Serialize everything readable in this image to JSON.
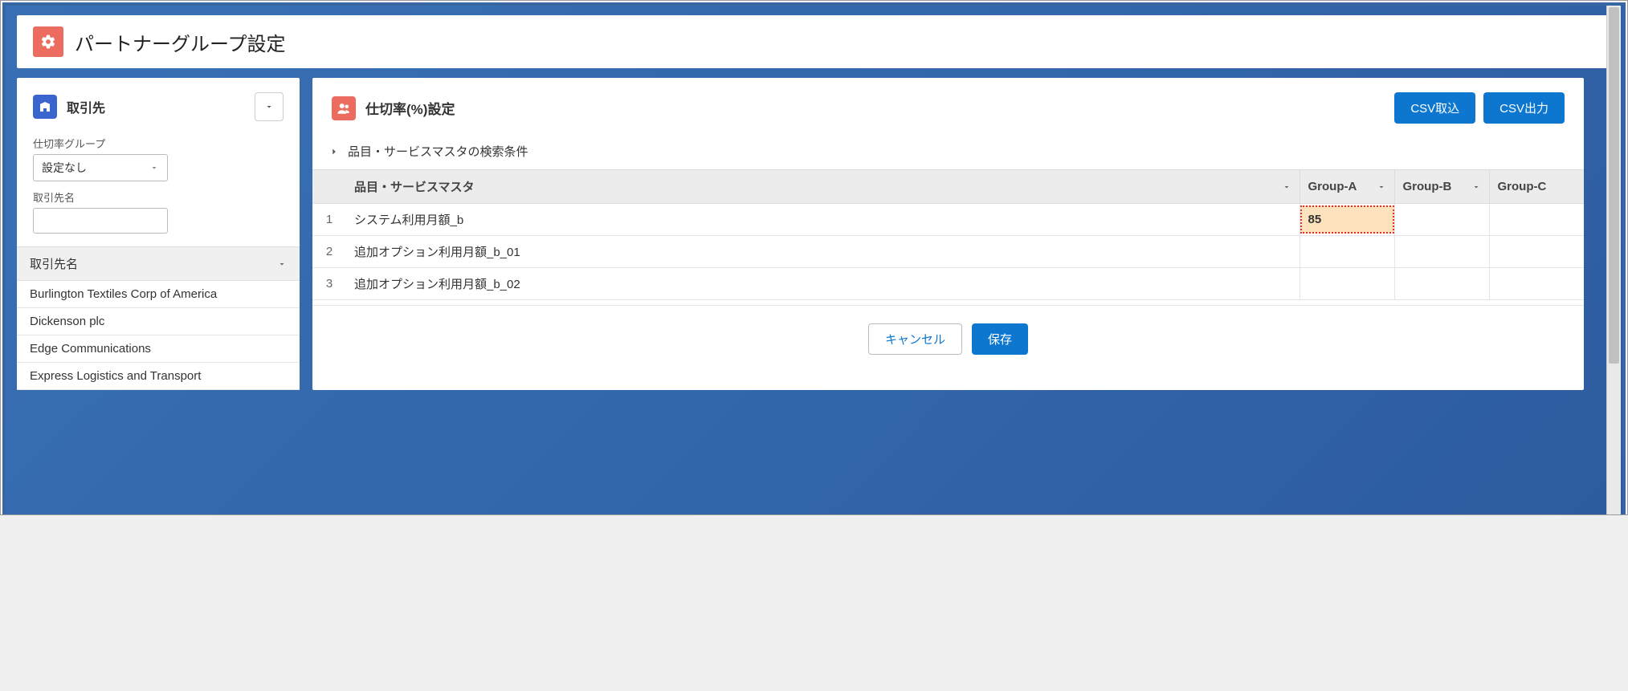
{
  "page": {
    "title": "パートナーグループ設定"
  },
  "sidebar": {
    "title": "取引先",
    "filter": {
      "group_label": "仕切率グループ",
      "group_value": "設定なし",
      "name_label": "取引先名",
      "name_value": ""
    },
    "list_header": "取引先名",
    "items": [
      "Burlington Textiles Corp of America",
      "Dickenson plc",
      "Edge Communications",
      "Express Logistics and Transport"
    ]
  },
  "main": {
    "title": "仕切率(%)設定",
    "csv_import": "CSV取込",
    "csv_export": "CSV出力",
    "search_cond": "品目・サービスマスタの検索条件",
    "columns": {
      "master": "品目・サービスマスタ",
      "g1": "Group-A",
      "g2": "Group-B",
      "g3": "Group-C"
    },
    "rows": [
      {
        "idx": "1",
        "name": "システム利用月額_b",
        "g1": "85",
        "g2": "",
        "g3": ""
      },
      {
        "idx": "2",
        "name": "追加オプション利用月額_b_01",
        "g1": "",
        "g2": "",
        "g3": ""
      },
      {
        "idx": "3",
        "name": "追加オプション利用月額_b_02",
        "g1": "",
        "g2": "",
        "g3": ""
      }
    ],
    "cancel": "キャンセル",
    "save": "保存"
  }
}
